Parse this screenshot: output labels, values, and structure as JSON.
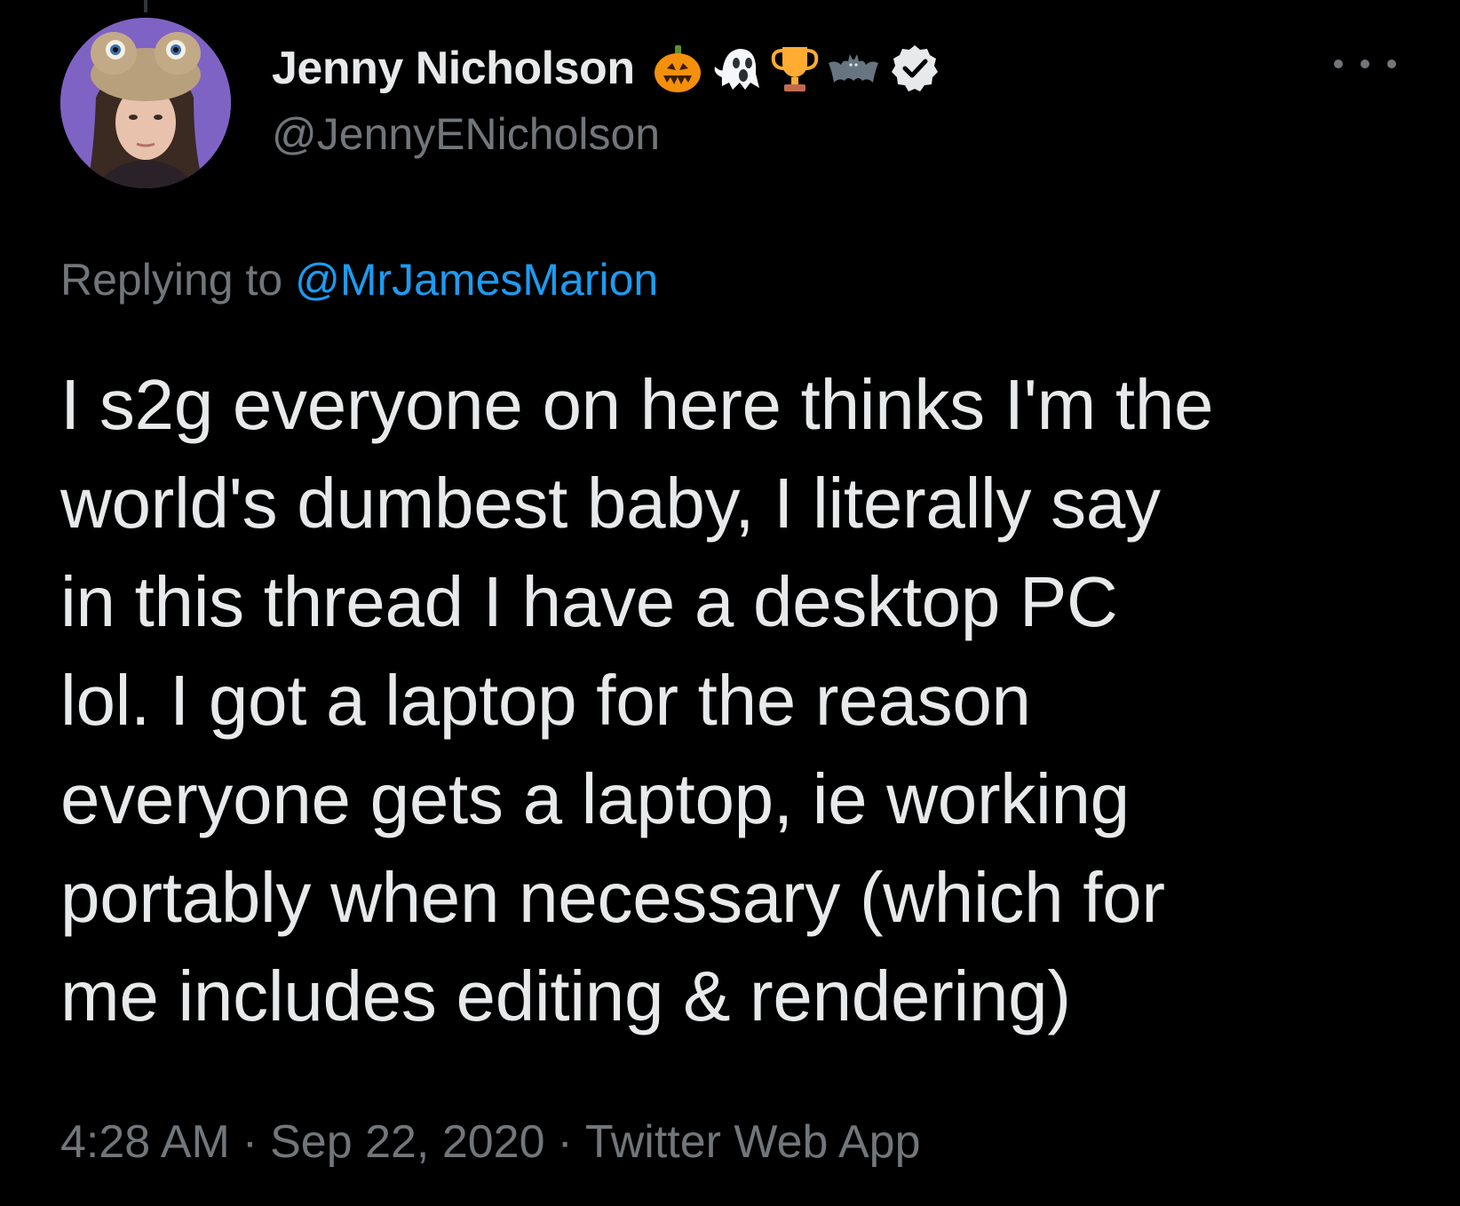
{
  "author": {
    "display_name": "Jenny Nicholson",
    "handle": "@JennyENicholson",
    "name_emojis": [
      "jack-o-lantern-icon",
      "ghost-icon",
      "trophy-icon",
      "bat-icon"
    ],
    "verified": true
  },
  "reply": {
    "prefix": "Replying to",
    "mention": "@MrJamesMarion"
  },
  "tweet": {
    "lines": [
      "I s2g everyone on here thinks I'm the",
      "world's dumbest baby, I literally say",
      "in this thread I have a desktop PC",
      "lol. I got a laptop for the reason",
      "everyone gets a laptop, ie working",
      "portably when necessary (which for",
      "me includes editing & rendering)"
    ]
  },
  "meta": {
    "time": "4:28 AM",
    "separator": "·",
    "date": "Sep 22, 2020",
    "source": "Twitter Web App"
  },
  "colors": {
    "background": "#000000",
    "text": "#e7e9ea",
    "secondary": "#71767b",
    "link": "#1d9bf0"
  }
}
